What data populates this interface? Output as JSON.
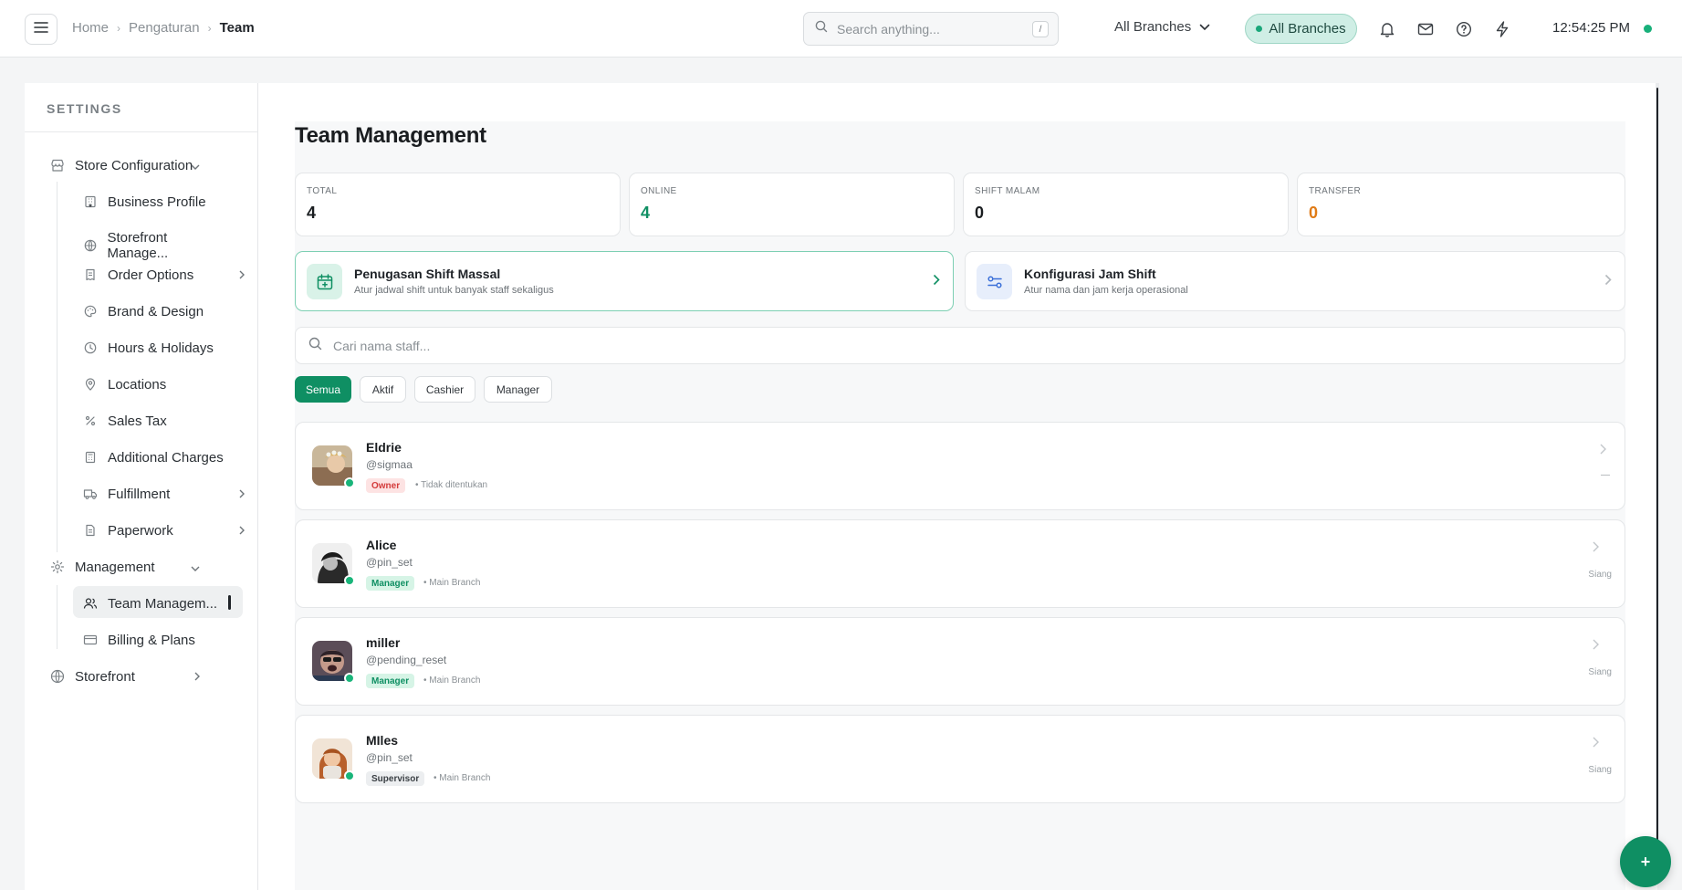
{
  "topbar": {
    "breadcrumb": [
      "Home",
      "Pengaturan",
      "Team"
    ],
    "search_placeholder": "Search anything...",
    "search_shortcut": "/",
    "branch_select": "All Branches",
    "branch_pill": "All Branches",
    "clock": "12:54:25 PM"
  },
  "sidebar": {
    "title": "SETTINGS",
    "groups": {
      "store": "Store Configuration",
      "management": "Management",
      "storefront": "Storefront"
    },
    "items": {
      "business_profile": "Business Profile",
      "storefront_manage": "Storefront Manage...",
      "order_options": "Order Options",
      "brand_design": "Brand & Design",
      "hours_holidays": "Hours & Holidays",
      "locations": "Locations",
      "sales_tax": "Sales Tax",
      "additional_charges": "Additional Charges",
      "fulfillment": "Fulfillment",
      "paperwork": "Paperwork",
      "team_management": "Team Managem...",
      "billing_plans": "Billing & Plans"
    }
  },
  "main": {
    "title": "Team Management",
    "stats": [
      {
        "label": "TOTAL",
        "value": "4",
        "color": "#1a1d20"
      },
      {
        "label": "ONLINE",
        "value": "4",
        "color": "#0f8f63"
      },
      {
        "label": "SHIFT MALAM",
        "value": "0",
        "color": "#1a1d20"
      },
      {
        "label": "TRANSFER",
        "value": "0",
        "color": "#e07b16"
      }
    ],
    "actions": [
      {
        "title": "Penugasan Shift Massal",
        "subtitle": "Atur jadwal shift untuk banyak staff sekaligus"
      },
      {
        "title": "Konfigurasi Jam Shift",
        "subtitle": "Atur nama dan jam kerja operasional"
      }
    ],
    "staff_search_placeholder": "Cari nama staff...",
    "filters": [
      "Semua",
      "Aktif",
      "Cashier",
      "Manager"
    ],
    "staff": [
      {
        "name": "Eldrie",
        "username": "@sigmaa",
        "role": "Owner",
        "branch": "• Tidak ditentukan",
        "shift": "—"
      },
      {
        "name": "Alice",
        "username": "@pin_set",
        "role": "Manager",
        "branch": "• Main Branch",
        "shift": "Siang"
      },
      {
        "name": "miller",
        "username": "@pending_reset",
        "role": "Manager",
        "branch": "• Main Branch",
        "shift": "Siang"
      },
      {
        "name": "MIles",
        "username": "@pin_set",
        "role": "Supervisor",
        "branch": "• Main Branch",
        "shift": "Siang"
      }
    ],
    "fab_label": "+"
  }
}
